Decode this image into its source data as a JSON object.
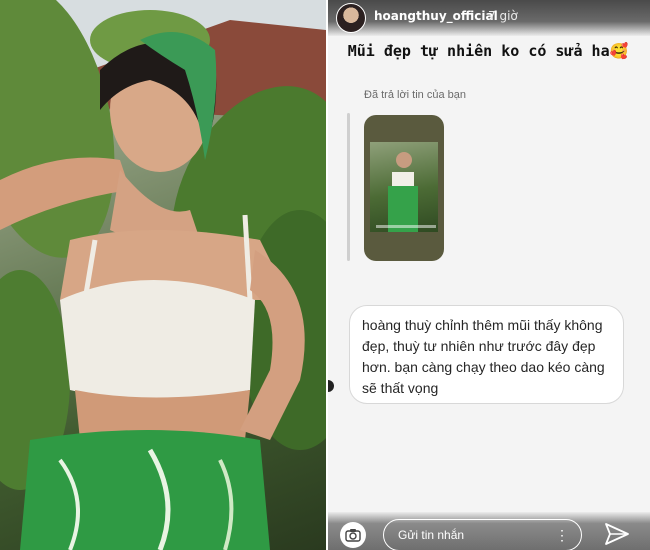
{
  "header": {
    "username": "hoangthuy_official",
    "timestamp": "7 giờ"
  },
  "story": {
    "caption": "Mũi đẹp tự nhiên ko có sửa ha🥰",
    "reply_note": "Đã trả lời tin của bạn",
    "message": "hoàng thuỳ chỉnh thêm mũi thấy không đẹp, thuỳ tư nhiên như trước đây đẹp hơn. bạn càng chạy theo dao kéo càng sẽ thất vọng"
  },
  "footer": {
    "reply_placeholder": "Gửi tin nhắn",
    "more_label": "⋮"
  },
  "icons": {
    "camera": "camera-icon",
    "send": "send-icon"
  },
  "colors": {
    "bubble_border": "#d8d8d8",
    "story_bg": "#f4f4f4"
  }
}
